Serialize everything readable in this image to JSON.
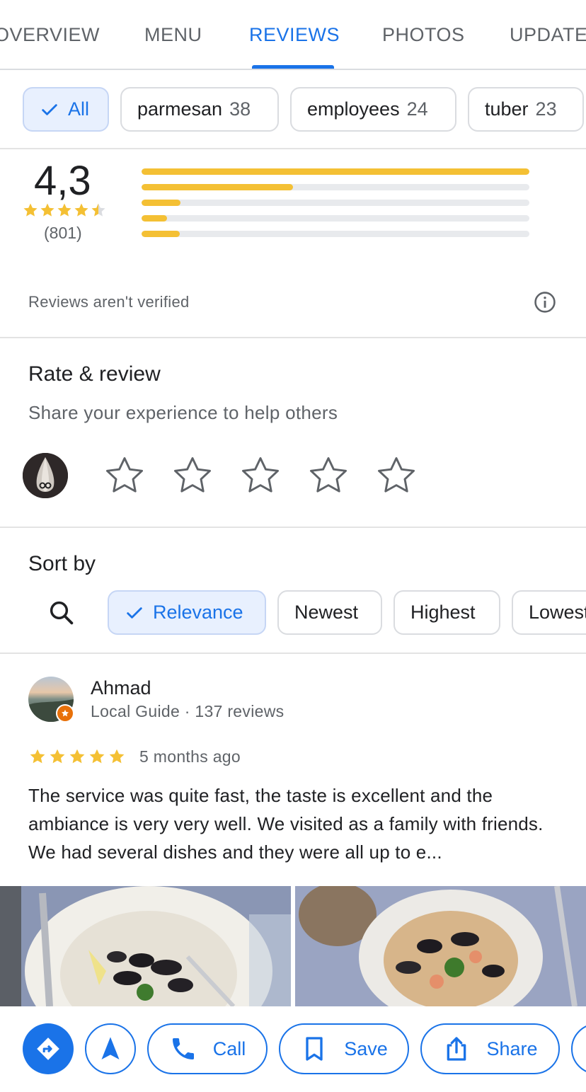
{
  "tabs": [
    {
      "label": "OVERVIEW"
    },
    {
      "label": "MENU"
    },
    {
      "label": "REVIEWS"
    },
    {
      "label": "PHOTOS"
    },
    {
      "label": "UPDATES"
    }
  ],
  "active_tab": "REVIEWS",
  "topic_chips": [
    {
      "label": "All",
      "count": ""
    },
    {
      "label": "parmesan",
      "count": "38"
    },
    {
      "label": "employees",
      "count": "24"
    },
    {
      "label": "tuber",
      "count": "23"
    }
  ],
  "summary": {
    "rating": "4,3",
    "review_count": "(801)",
    "star_rating_value": 4.3,
    "distribution": [
      {
        "stars": 5,
        "fraction": 1.0
      },
      {
        "stars": 4,
        "fraction": 0.39
      },
      {
        "stars": 3,
        "fraction": 0.1
      },
      {
        "stars": 2,
        "fraction": 0.065
      },
      {
        "stars": 1,
        "fraction": 0.098
      }
    ],
    "unverified_notice": "Reviews aren't verified"
  },
  "rate_review": {
    "title": "Rate & review",
    "subtitle": "Share your experience to help others"
  },
  "sort": {
    "title": "Sort by",
    "options": [
      "Relevance",
      "Newest",
      "Highest",
      "Lowest"
    ],
    "selected": "Relevance"
  },
  "review": {
    "author": "Ahmad",
    "meta": "Local Guide · 137 reviews",
    "stars": 5,
    "date": "5 months ago",
    "text": "The service was quite fast, the taste is excellent and the ambiance is very very well. We visited as a family with friends. We had several dishes and they were all up to e..."
  },
  "actions": {
    "call": "Call",
    "save": "Save",
    "share": "Share"
  },
  "colors": {
    "accent": "#1a73e8",
    "star": "#f4c034",
    "chip_selected_bg": "#e8f0fe"
  }
}
